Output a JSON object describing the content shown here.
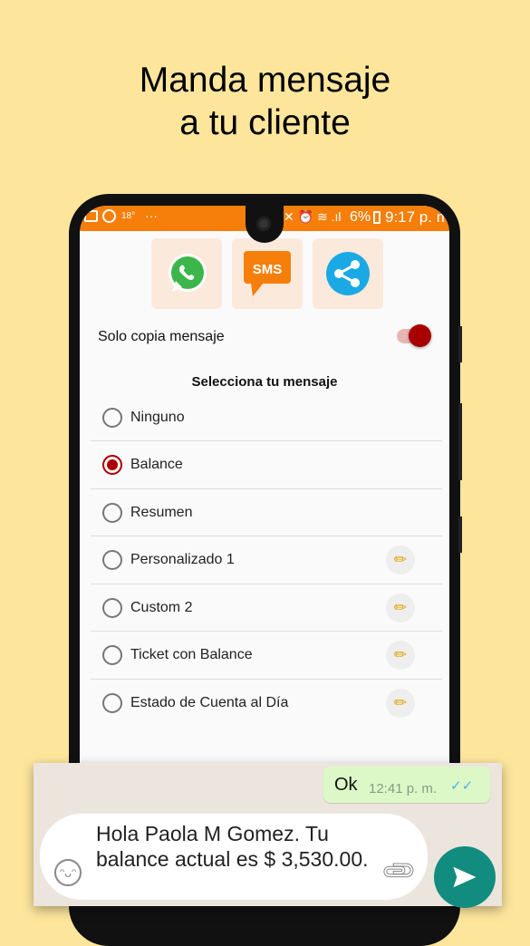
{
  "headline": {
    "line1": "Manda mensaje",
    "line2": "a tu cliente"
  },
  "status_bar": {
    "temp": "18°",
    "dots": "···",
    "battery": "6%",
    "time": "9:17 p. m.",
    "color": "#f57f0a"
  },
  "share": {
    "whatsapp_icon": "whatsapp-icon",
    "sms_label": "SMS",
    "share_icon": "share-icon"
  },
  "copy_toggle": {
    "label": "Solo copia mensaje",
    "on": true,
    "accent": "#aa0000"
  },
  "message_select": {
    "heading": "Selecciona tu mensaje",
    "options": [
      {
        "label": "Ninguno",
        "selected": false,
        "editable": false
      },
      {
        "label": "Balance",
        "selected": true,
        "editable": false
      },
      {
        "label": "Resumen",
        "selected": false,
        "editable": false
      },
      {
        "label": "Personalizado 1",
        "selected": false,
        "editable": true
      },
      {
        "label": "Custom 2",
        "selected": false,
        "editable": true
      },
      {
        "label": "Ticket con Balance",
        "selected": false,
        "editable": true
      },
      {
        "label": "Estado de Cuenta al Día",
        "selected": false,
        "editable": true
      }
    ]
  },
  "chat": {
    "sent_text": "Ok",
    "sent_time": "12:41 p. m.",
    "input_text": "Hola Paola M Gomez. Tu balance actual es $ 3,530.00.",
    "send_color": "#128c7e"
  }
}
